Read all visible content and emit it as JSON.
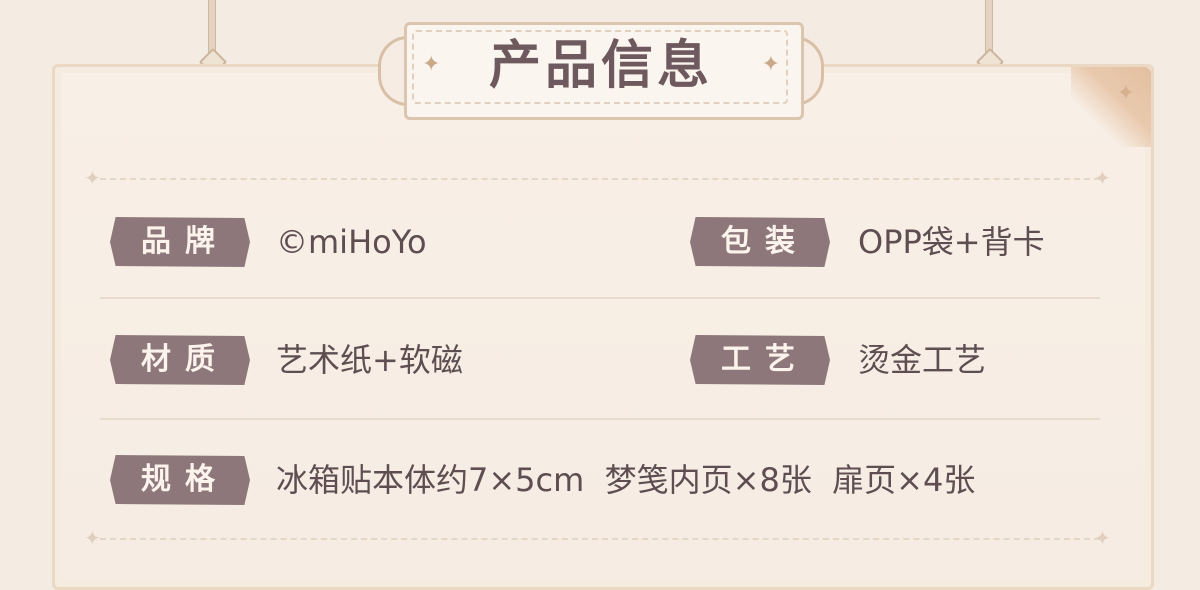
{
  "section_title": "产品信息",
  "info": {
    "brand": {
      "label": "品牌",
      "value": "©miHoYo"
    },
    "packaging": {
      "label": "包装",
      "value": "OPP袋+背卡"
    },
    "material": {
      "label": "材质",
      "value": "艺术纸+软磁"
    },
    "craft": {
      "label": "工艺",
      "value": "烫金工艺"
    },
    "spec": {
      "label": "规格",
      "value": "冰箱贴本体约7×5cm  梦笺内页×8张  扉页×4张"
    }
  },
  "colors": {
    "background": "#f4ebe3",
    "tag_fill": "#8d777a",
    "text": "#5e4e52",
    "title": "#6e5a5e"
  }
}
